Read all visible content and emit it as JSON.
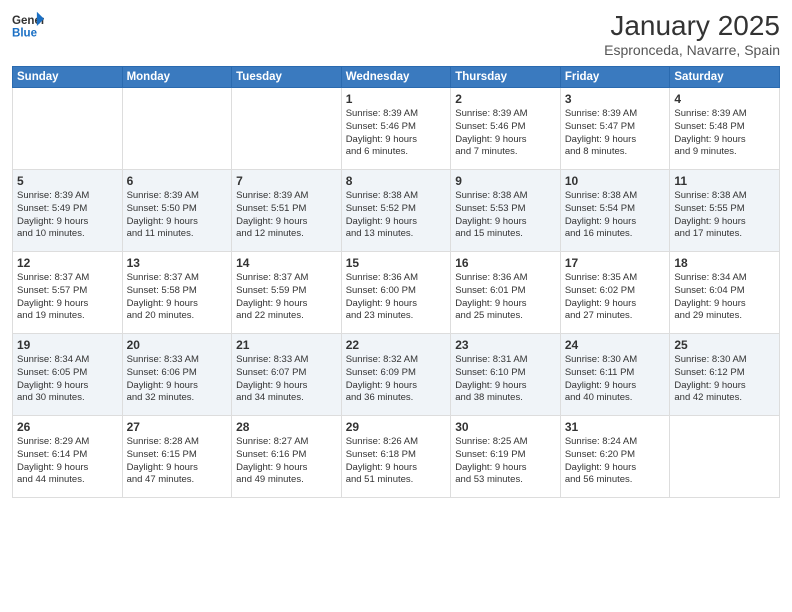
{
  "logo": {
    "line1": "General",
    "line2": "Blue"
  },
  "title": "January 2025",
  "subtitle": "Espronceda, Navarre, Spain",
  "days_of_week": [
    "Sunday",
    "Monday",
    "Tuesday",
    "Wednesday",
    "Thursday",
    "Friday",
    "Saturday"
  ],
  "weeks": [
    [
      {
        "day": "",
        "text": ""
      },
      {
        "day": "",
        "text": ""
      },
      {
        "day": "",
        "text": ""
      },
      {
        "day": "1",
        "text": "Sunrise: 8:39 AM\nSunset: 5:46 PM\nDaylight: 9 hours\nand 6 minutes."
      },
      {
        "day": "2",
        "text": "Sunrise: 8:39 AM\nSunset: 5:46 PM\nDaylight: 9 hours\nand 7 minutes."
      },
      {
        "day": "3",
        "text": "Sunrise: 8:39 AM\nSunset: 5:47 PM\nDaylight: 9 hours\nand 8 minutes."
      },
      {
        "day": "4",
        "text": "Sunrise: 8:39 AM\nSunset: 5:48 PM\nDaylight: 9 hours\nand 9 minutes."
      }
    ],
    [
      {
        "day": "5",
        "text": "Sunrise: 8:39 AM\nSunset: 5:49 PM\nDaylight: 9 hours\nand 10 minutes."
      },
      {
        "day": "6",
        "text": "Sunrise: 8:39 AM\nSunset: 5:50 PM\nDaylight: 9 hours\nand 11 minutes."
      },
      {
        "day": "7",
        "text": "Sunrise: 8:39 AM\nSunset: 5:51 PM\nDaylight: 9 hours\nand 12 minutes."
      },
      {
        "day": "8",
        "text": "Sunrise: 8:38 AM\nSunset: 5:52 PM\nDaylight: 9 hours\nand 13 minutes."
      },
      {
        "day": "9",
        "text": "Sunrise: 8:38 AM\nSunset: 5:53 PM\nDaylight: 9 hours\nand 15 minutes."
      },
      {
        "day": "10",
        "text": "Sunrise: 8:38 AM\nSunset: 5:54 PM\nDaylight: 9 hours\nand 16 minutes."
      },
      {
        "day": "11",
        "text": "Sunrise: 8:38 AM\nSunset: 5:55 PM\nDaylight: 9 hours\nand 17 minutes."
      }
    ],
    [
      {
        "day": "12",
        "text": "Sunrise: 8:37 AM\nSunset: 5:57 PM\nDaylight: 9 hours\nand 19 minutes."
      },
      {
        "day": "13",
        "text": "Sunrise: 8:37 AM\nSunset: 5:58 PM\nDaylight: 9 hours\nand 20 minutes."
      },
      {
        "day": "14",
        "text": "Sunrise: 8:37 AM\nSunset: 5:59 PM\nDaylight: 9 hours\nand 22 minutes."
      },
      {
        "day": "15",
        "text": "Sunrise: 8:36 AM\nSunset: 6:00 PM\nDaylight: 9 hours\nand 23 minutes."
      },
      {
        "day": "16",
        "text": "Sunrise: 8:36 AM\nSunset: 6:01 PM\nDaylight: 9 hours\nand 25 minutes."
      },
      {
        "day": "17",
        "text": "Sunrise: 8:35 AM\nSunset: 6:02 PM\nDaylight: 9 hours\nand 27 minutes."
      },
      {
        "day": "18",
        "text": "Sunrise: 8:34 AM\nSunset: 6:04 PM\nDaylight: 9 hours\nand 29 minutes."
      }
    ],
    [
      {
        "day": "19",
        "text": "Sunrise: 8:34 AM\nSunset: 6:05 PM\nDaylight: 9 hours\nand 30 minutes."
      },
      {
        "day": "20",
        "text": "Sunrise: 8:33 AM\nSunset: 6:06 PM\nDaylight: 9 hours\nand 32 minutes."
      },
      {
        "day": "21",
        "text": "Sunrise: 8:33 AM\nSunset: 6:07 PM\nDaylight: 9 hours\nand 34 minutes."
      },
      {
        "day": "22",
        "text": "Sunrise: 8:32 AM\nSunset: 6:09 PM\nDaylight: 9 hours\nand 36 minutes."
      },
      {
        "day": "23",
        "text": "Sunrise: 8:31 AM\nSunset: 6:10 PM\nDaylight: 9 hours\nand 38 minutes."
      },
      {
        "day": "24",
        "text": "Sunrise: 8:30 AM\nSunset: 6:11 PM\nDaylight: 9 hours\nand 40 minutes."
      },
      {
        "day": "25",
        "text": "Sunrise: 8:30 AM\nSunset: 6:12 PM\nDaylight: 9 hours\nand 42 minutes."
      }
    ],
    [
      {
        "day": "26",
        "text": "Sunrise: 8:29 AM\nSunset: 6:14 PM\nDaylight: 9 hours\nand 44 minutes."
      },
      {
        "day": "27",
        "text": "Sunrise: 8:28 AM\nSunset: 6:15 PM\nDaylight: 9 hours\nand 47 minutes."
      },
      {
        "day": "28",
        "text": "Sunrise: 8:27 AM\nSunset: 6:16 PM\nDaylight: 9 hours\nand 49 minutes."
      },
      {
        "day": "29",
        "text": "Sunrise: 8:26 AM\nSunset: 6:18 PM\nDaylight: 9 hours\nand 51 minutes."
      },
      {
        "day": "30",
        "text": "Sunrise: 8:25 AM\nSunset: 6:19 PM\nDaylight: 9 hours\nand 53 minutes."
      },
      {
        "day": "31",
        "text": "Sunrise: 8:24 AM\nSunset: 6:20 PM\nDaylight: 9 hours\nand 56 minutes."
      },
      {
        "day": "",
        "text": ""
      }
    ]
  ]
}
